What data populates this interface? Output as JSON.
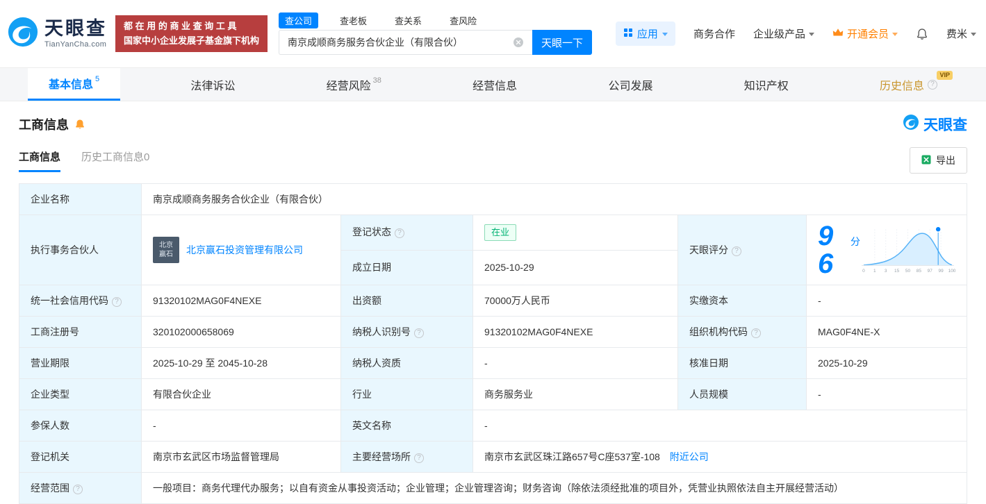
{
  "header": {
    "logo": {
      "cn": "天眼查",
      "en": "TianYanCha.com"
    },
    "slogan": {
      "line1": "都 在 用 的 商 业 查 询 工 具",
      "line2": "国家中小企业发展子基金旗下机构"
    },
    "search": {
      "tabs": [
        {
          "label": "查公司"
        },
        {
          "label": "查老板"
        },
        {
          "label": "查关系"
        },
        {
          "label": "查风险"
        }
      ],
      "value": "南京成顺商务服务合伙企业（有限合伙）",
      "button": "天眼一下"
    },
    "menu": {
      "apps": "应用",
      "cooperation": "商务合作",
      "enterprise": "企业级产品",
      "vip": "开通会员",
      "user": "费米"
    }
  },
  "nav": {
    "tabs": [
      {
        "label": "基本信息",
        "count": "5"
      },
      {
        "label": "法律诉讼",
        "count": ""
      },
      {
        "label": "经营风险",
        "count": "38"
      },
      {
        "label": "经营信息",
        "count": ""
      },
      {
        "label": "公司发展",
        "count": ""
      },
      {
        "label": "知识产权",
        "count": ""
      },
      {
        "label": "历史信息",
        "count": "",
        "badge": "VIP"
      }
    ]
  },
  "section": {
    "title": "工商信息",
    "brand": "天眼查",
    "subtabs": [
      {
        "label": "工商信息"
      },
      {
        "label": "历史工商信息0"
      }
    ],
    "export_label": "导出"
  },
  "info": {
    "company_name_label": "企业名称",
    "company_name": "南京成顺商务服务合伙企业（有限合伙）",
    "executive_partner_label": "执行事务合伙人",
    "executive_partner_logo_top": "北京",
    "executive_partner_logo_bottom": "赢石",
    "executive_partner": "北京赢石投资管理有限公司",
    "reg_status_label": "登记状态",
    "reg_status": "在业",
    "establish_date_label": "成立日期",
    "establish_date": "2025-10-29",
    "score_label": "天眼评分",
    "score_value": "96",
    "score_unit": "分",
    "credit_code_label": "统一社会信用代码",
    "credit_code": "91320102MAG0F4NEXE",
    "capital_label": "出资额",
    "capital": "70000万人民币",
    "paid_capital_label": "实缴资本",
    "paid_capital": "-",
    "reg_number_label": "工商注册号",
    "reg_number": "320102000658069",
    "taxpayer_id_label": "纳税人识别号",
    "taxpayer_id": "91320102MAG0F4NEXE",
    "org_code_label": "组织机构代码",
    "org_code": "MAG0F4NE-X",
    "business_term_label": "营业期限",
    "business_term": "2025-10-29 至 2045-10-28",
    "taxpayer_quality_label": "纳税人资质",
    "taxpayer_quality": "-",
    "approval_date_label": "核准日期",
    "approval_date": "2025-10-29",
    "company_type_label": "企业类型",
    "company_type": "有限合伙企业",
    "industry_label": "行业",
    "industry": "商务服务业",
    "staff_size_label": "人员规模",
    "staff_size": "-",
    "insured_label": "参保人数",
    "insured": "-",
    "english_name_label": "英文名称",
    "english_name": "-",
    "reg_authority_label": "登记机关",
    "reg_authority": "南京市玄武区市场监督管理局",
    "business_address_label": "主要经营场所",
    "business_address": "南京市玄武区珠江路657号C座537室-108",
    "nearby_link": "附近公司",
    "business_scope_label": "经营范围",
    "business_scope": "一般项目：商务代理代办服务；以自有资金从事投资活动；企业管理；企业管理咨询；财务咨询（除依法须经批准的项目外，凭营业执照依法自主开展经营活动）"
  },
  "score_chart": {
    "type": "area",
    "score": 96,
    "axis_labels": [
      "0",
      "1",
      "3",
      "15",
      "50",
      "85",
      "97",
      "99",
      "100"
    ]
  }
}
